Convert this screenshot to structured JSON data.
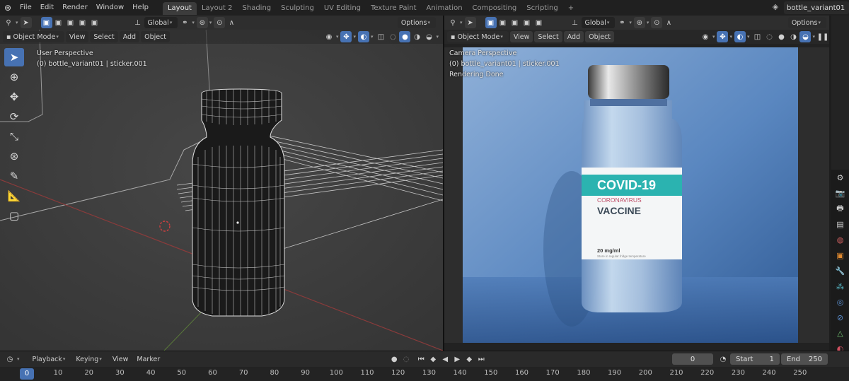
{
  "app": {
    "menu": [
      "File",
      "Edit",
      "Render",
      "Window",
      "Help"
    ],
    "workspace_tabs": [
      "Layout",
      "Layout 2",
      "Shading",
      "Sculpting",
      "UV Editing",
      "Texture Paint",
      "Animation",
      "Compositing",
      "Scripting"
    ],
    "active_tab": "Layout",
    "scene_name": "bottle_variant01",
    "add_tab": "+"
  },
  "left_viewport": {
    "transform_orientation": "Global",
    "options_label": "Options",
    "mode": "Object Mode",
    "menus": [
      "View",
      "Select",
      "Add",
      "Object"
    ],
    "perspective": "User Perspective",
    "object_info": "(0) bottle_variant01 | sticker.001"
  },
  "right_viewport": {
    "transform_orientation": "Global",
    "options_label": "Options",
    "mode": "Object Mode",
    "menus": [
      "View",
      "Select",
      "Add",
      "Object"
    ],
    "perspective": "Camera Perspective",
    "object_info": "(0) bottle_variant01 | sticker.001",
    "status": "Rendering Done",
    "label": {
      "headline": "COVID-19",
      "subtitle": "CORONAVIRUS",
      "product": "VACCINE",
      "dose": "20 mg/ml",
      "note": "Store in regular fridge temperature"
    }
  },
  "timeline": {
    "menus": [
      "Playback",
      "Keying",
      "View",
      "Marker"
    ],
    "current_frame": "0",
    "start_label": "Start",
    "start_value": "1",
    "end_label": "End",
    "end_value": "250",
    "ruler_current": "0",
    "ruler_ticks": [
      "10",
      "20",
      "30",
      "40",
      "50",
      "60",
      "70",
      "80",
      "90",
      "100",
      "110",
      "120",
      "130",
      "140",
      "150",
      "160",
      "170",
      "180",
      "190",
      "200",
      "210",
      "220",
      "230",
      "240",
      "250"
    ]
  },
  "colors": {
    "accent": "#4772b3",
    "label_teal": "#2bb3b0",
    "backdrop_blue": "#5a87c0"
  }
}
